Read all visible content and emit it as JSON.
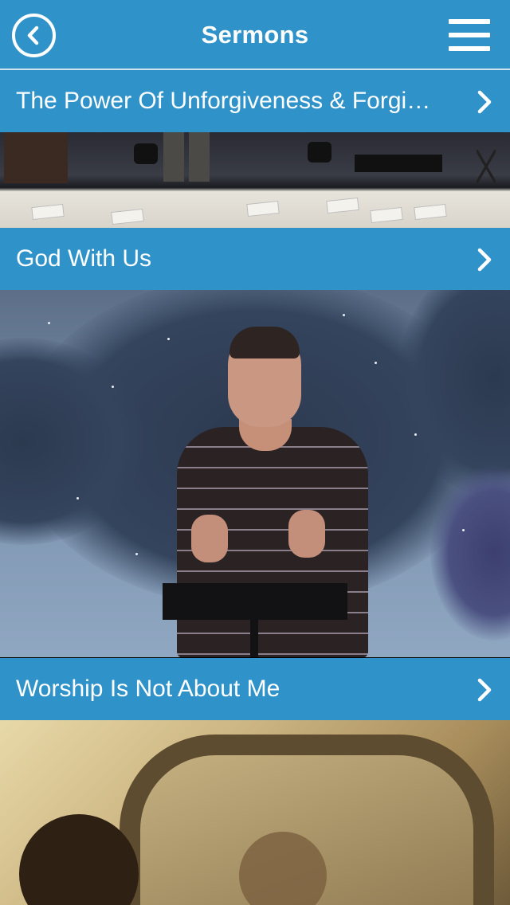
{
  "header": {
    "title": "Sermons",
    "back_icon": "back-circle-icon",
    "menu_icon": "hamburger-menu-icon"
  },
  "sermons": [
    {
      "title": "The Power Of Unforgiveness & Forgi…"
    },
    {
      "title": "God With Us"
    },
    {
      "title": "Worship Is Not About Me"
    }
  ],
  "colors": {
    "bar_blue": "#2f92c9",
    "text": "#ffffff"
  }
}
